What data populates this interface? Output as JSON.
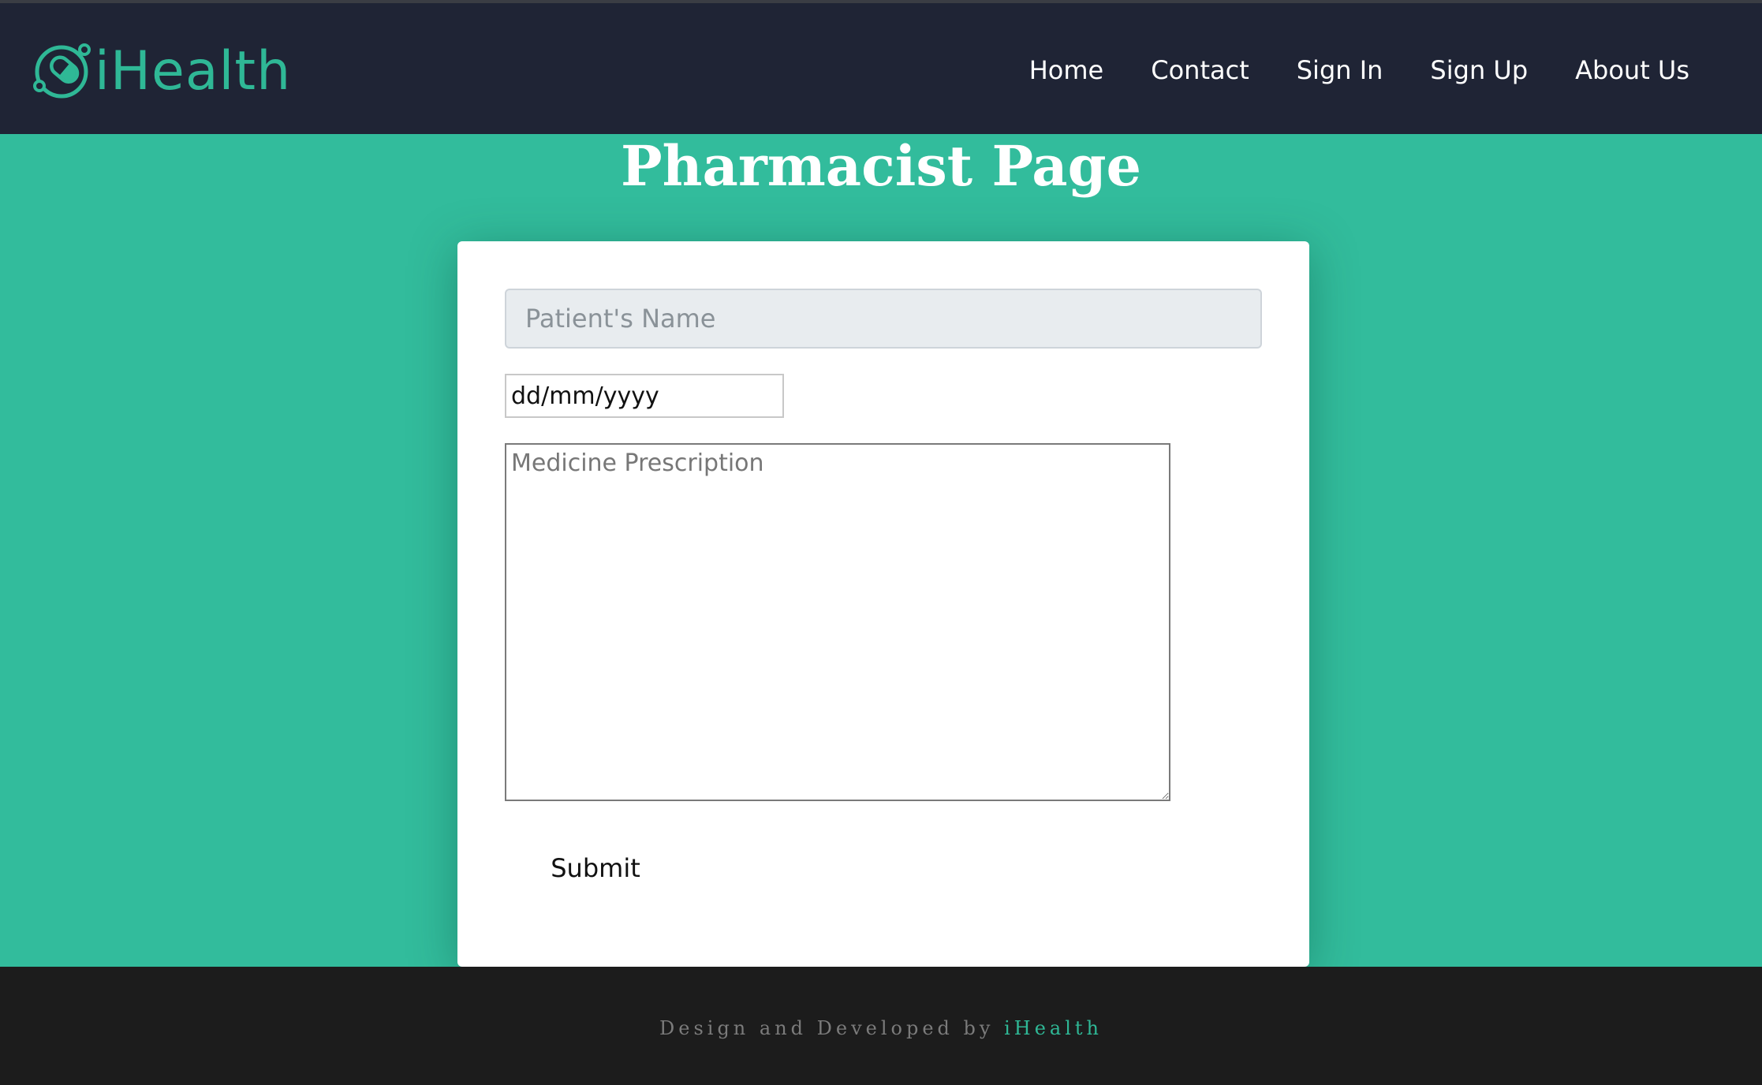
{
  "brand": {
    "logo_text": "iHealth",
    "logo_icon": "pill-capsule-icon",
    "accent_color": "#2fb896"
  },
  "nav": {
    "items": [
      {
        "label": "Home"
      },
      {
        "label": "Contact"
      },
      {
        "label": "Sign In"
      },
      {
        "label": "Sign Up"
      },
      {
        "label": "About Us"
      }
    ]
  },
  "page": {
    "title": "Pharmacist Page",
    "background_color": "#32bc9c"
  },
  "form": {
    "patient_name_placeholder": "Patient's Name",
    "date_value": "dd/mm/yyyy",
    "prescription_placeholder": "Medicine Prescription",
    "submit_label": "Submit"
  },
  "footer": {
    "prefix": "Design and Developed by ",
    "brand": "iHealth"
  }
}
